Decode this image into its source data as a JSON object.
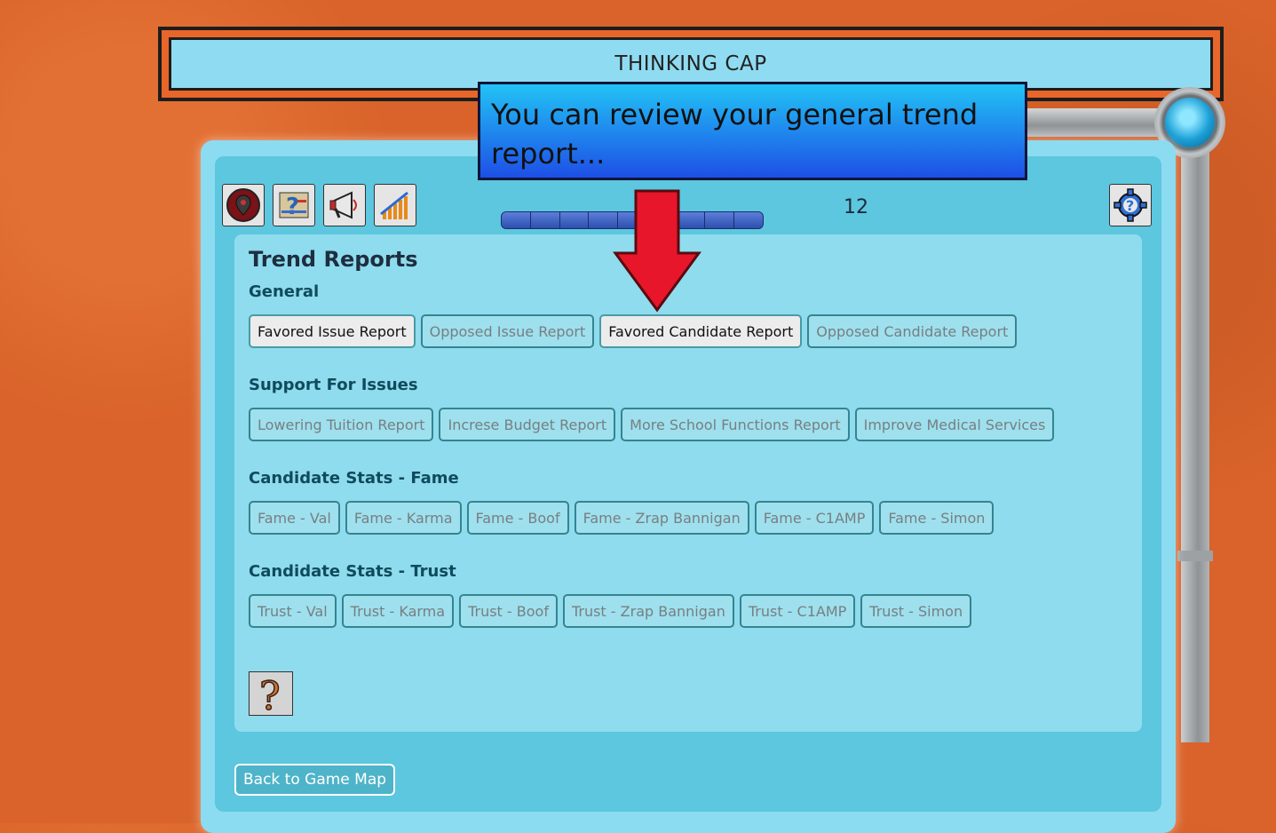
{
  "window": {
    "title": "THINKING CAP"
  },
  "toolbar": {
    "icons": [
      "map-pin-icon",
      "report-map-icon",
      "megaphone-icon",
      "bar-chart-icon"
    ],
    "settings_icon": "gear-help-icon",
    "counter_value": "12",
    "progress_segments": 9
  },
  "tutorial": {
    "message": "You can review your general trend report..."
  },
  "trend": {
    "title": "Trend Reports",
    "sections": [
      {
        "label": "General",
        "buttons": [
          {
            "label": "Favored Issue Report",
            "active": true
          },
          {
            "label": "Opposed Issue Report",
            "active": false
          },
          {
            "label": "Favored Candidate Report",
            "active": true
          },
          {
            "label": "Opposed Candidate Report",
            "active": false
          }
        ]
      },
      {
        "label": "Support For Issues",
        "buttons": [
          {
            "label": "Lowering Tuition Report",
            "active": false
          },
          {
            "label": "Increse Budget Report",
            "active": false
          },
          {
            "label": "More School Functions Report",
            "active": false
          },
          {
            "label": "Improve Medical Services",
            "active": false
          }
        ]
      },
      {
        "label": "Candidate Stats - Fame",
        "buttons": [
          {
            "label": "Fame - Val",
            "active": false
          },
          {
            "label": "Fame - Karma",
            "active": false
          },
          {
            "label": "Fame - Boof",
            "active": false
          },
          {
            "label": "Fame - Zrap Bannigan",
            "active": false
          },
          {
            "label": "Fame - C1AMP",
            "active": false
          },
          {
            "label": "Fame - Simon",
            "active": false
          }
        ]
      },
      {
        "label": "Candidate Stats - Trust",
        "buttons": [
          {
            "label": "Trust - Val",
            "active": false
          },
          {
            "label": "Trust - Karma",
            "active": false
          },
          {
            "label": "Trust - Boof",
            "active": false
          },
          {
            "label": "Trust - Zrap Bannigan",
            "active": false
          },
          {
            "label": "Trust - C1AMP",
            "active": false
          },
          {
            "label": "Trust - Simon",
            "active": false
          }
        ]
      }
    ],
    "help_icon": "question-mark-icon"
  },
  "footer": {
    "back_label": "Back to Game Map"
  },
  "colors": {
    "accent": "#5cc7df",
    "arrow": "#e8162a",
    "tooltip": "#1d4fe6"
  }
}
